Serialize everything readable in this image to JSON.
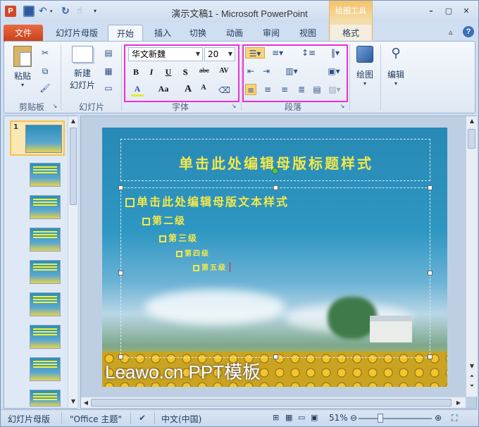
{
  "app": {
    "title": "演示文稿1 - Microsoft PowerPoint",
    "logo": "P",
    "context_tools": "绘图工具",
    "help": "?",
    "ribbon_min": "▵",
    "window_controls": {
      "minimize": "–",
      "maximize": "▢",
      "close": "✕"
    }
  },
  "tabs": [
    {
      "label": "文件"
    },
    {
      "label": "幻灯片母版"
    },
    {
      "label": "开始"
    },
    {
      "label": "插入"
    },
    {
      "label": "切换"
    },
    {
      "label": "动画"
    },
    {
      "label": "审阅"
    },
    {
      "label": "视图"
    },
    {
      "label": "格式"
    }
  ],
  "ribbon": {
    "clipboard": {
      "label": "剪贴板",
      "paste": "粘贴"
    },
    "slides": {
      "label": "幻灯片",
      "new_slide": "新建",
      "new_slide2": "幻灯片"
    },
    "font": {
      "label": "字体",
      "font_name": "华文新魏",
      "font_size": "20",
      "bold": "B",
      "italic": "I",
      "underline": "U",
      "shadow": "S",
      "strike": "abc",
      "spacing": "AV",
      "color": "A",
      "case": "Aa",
      "grow": "A",
      "shrink": "A"
    },
    "paragraph": {
      "label": "段落"
    },
    "drawing": {
      "label": "绘图"
    },
    "editing": {
      "label": "编辑"
    }
  },
  "slide": {
    "title": "单击此处编辑母版标题样式",
    "levels": [
      "单击此处编辑母版文本样式",
      "第二级",
      "第三级",
      "第四级",
      "第五级"
    ],
    "footer": "Leawo.cn PPT模板"
  },
  "thumbnails": {
    "first_number": "1",
    "count": 10
  },
  "status": {
    "view": "幻灯片母版",
    "theme": "\"Office 主题\"",
    "language": "中文(中国)",
    "zoom": "51%",
    "zoom_value": 0.51
  },
  "colors": {
    "accent": "#c9411b",
    "highlight": "#e82fd8",
    "slide_text": "#f4e84a"
  }
}
